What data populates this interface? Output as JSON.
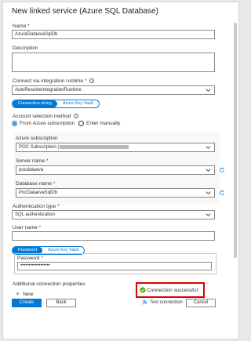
{
  "title": "New linked service (Azure SQL Database)",
  "name": {
    "label": "Name",
    "required": "*",
    "value": "AzureDataevaSqlDb"
  },
  "description": {
    "label": "Description"
  },
  "runtime": {
    "label": "Connect via integration runtime",
    "required": "*",
    "info": "i",
    "value": "AutoResolveIntegrationRuntime"
  },
  "auth_source_tabs": {
    "active": "Connection string",
    "inactive": "Azure Key Vault"
  },
  "account_selection": {
    "label": "Account selection method",
    "info": "i",
    "options": [
      "From Azure subscription",
      "Enter manually"
    ],
    "selected": "From Azure subscription"
  },
  "subscription": {
    "label": "Azure subscription",
    "value": "POC Subscription ("
  },
  "server": {
    "label": "Server name",
    "required": "*",
    "value": "pocdataeva"
  },
  "database": {
    "label": "Database name",
    "required": "*",
    "value": "PocDataevaSqlDb"
  },
  "auth_type": {
    "label": "Authentication type",
    "required": "*",
    "value": "SQL authentication"
  },
  "username": {
    "label": "User name",
    "required": "*"
  },
  "password_tabs": {
    "active": "Password",
    "inactive": "Azure Key Vault"
  },
  "password": {
    "label": "Password",
    "required": "*",
    "value": "••••••••••••••••••"
  },
  "additional": {
    "label": "Additional connection properties",
    "new_label": "New",
    "plus": "+"
  },
  "status": {
    "text": "Connection successful",
    "color": "#57a300"
  },
  "footer": {
    "create": "Create",
    "back": "Back",
    "test": "Test connection",
    "cancel": "Cancel"
  },
  "colors": {
    "accent": "#0078d4",
    "highlight": "#e00000"
  }
}
